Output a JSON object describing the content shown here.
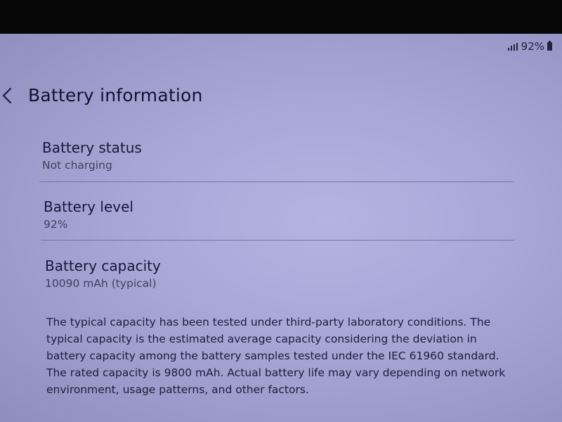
{
  "status_bar": {
    "signal_icon": "signal-icon",
    "battery_percent": "92%",
    "battery_icon": "battery-icon"
  },
  "header": {
    "back_icon": "chevron-left-icon",
    "title": "Battery information"
  },
  "items": [
    {
      "label": "Battery status",
      "value": "Not charging"
    },
    {
      "label": "Battery level",
      "value": "92%"
    },
    {
      "label": "Battery capacity",
      "value": "10090 mAh (typical)"
    }
  ],
  "note": "The typical capacity has been tested under third-party laboratory conditions. The typical capacity is the estimated average capacity considering the deviation in battery capacity among the battery samples tested under the IEC 61960 standard. The rated capacity is 9800 mAh. Actual battery life may vary depending on network environment, usage patterns, and other factors.",
  "colors": {
    "screen_background": "#a9a8d8",
    "text_primary": "#16163a",
    "text_secondary": "#3f3f62",
    "divider": "#6f6d98"
  }
}
